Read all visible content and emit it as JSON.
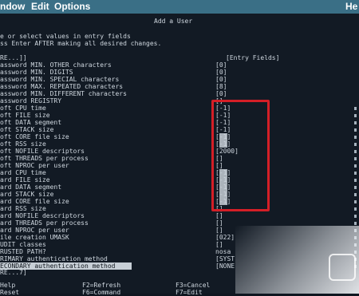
{
  "menubar": {
    "items": [
      "ndow",
      "Edit",
      "Options"
    ],
    "right_label": "He"
  },
  "dialog": {
    "title": "Add a User",
    "instructions": [
      "e or select values in entry fields",
      "ss Enter AFTER making all desired changes."
    ],
    "list_top": "RE...]]",
    "column_header": "[Entry Fields]",
    "list_more": "RE...7]"
  },
  "fields": [
    {
      "label": "assword MIN. OTHER characters",
      "value": "[0]"
    },
    {
      "label": "assword MIN. DIGITS",
      "value": "[0]"
    },
    {
      "label": "assword MIN. SPECIAL characters",
      "value": "[0]"
    },
    {
      "label": "assword MAX. REPEATED characters",
      "value": "[8]"
    },
    {
      "label": "assword MIN. DIFFERENT characters",
      "value": "[0]"
    },
    {
      "label": "assword REGISTRY",
      "value": "[]"
    },
    {
      "label": "oft CPU time",
      "value": "[-1]"
    },
    {
      "label": "oft FILE size",
      "value": "[-1]"
    },
    {
      "label": "oft DATA segment",
      "value": "[-1]"
    },
    {
      "label": "oft STACK size",
      "value": "[-1]"
    },
    {
      "label": "oft CORE file size",
      "value": "[-1]"
    },
    {
      "label": "oft RSS size",
      "value": "[-1]"
    },
    {
      "label": "oft NOFILE descriptors",
      "value": "[2000]"
    },
    {
      "label": "oft THREADS per process",
      "value": "[]"
    },
    {
      "label": "oft NPROC per user",
      "value": "[]"
    },
    {
      "label": "ard CPU time",
      "value": "[-1]"
    },
    {
      "label": "ard FILE size",
      "value": "[-1]"
    },
    {
      "label": "ard DATA segment",
      "value": "[-1]"
    },
    {
      "label": "ard STACK size",
      "value": "[-1]"
    },
    {
      "label": "ard CORE file size",
      "value": "[-1]"
    },
    {
      "label": "ard RSS size",
      "value": "[]"
    },
    {
      "label": "ard NOFILE descriptors",
      "value": "[]"
    },
    {
      "label": "ard THREADS per process",
      "value": "[]"
    },
    {
      "label": "ard NPROC per user",
      "value": "[]"
    },
    {
      "label": "ile creation UMASK",
      "value": "[022]"
    },
    {
      "label": "UDIT classes",
      "value": "[]"
    },
    {
      "label": "RUSTED PATH?",
      "value": "nosa"
    },
    {
      "label": "RIMARY authentication method",
      "value": "[SYST"
    },
    {
      "label": "ECONDARY authentication method",
      "value": "[NONE"
    }
  ],
  "function_keys": {
    "row1": [
      "Help",
      "F2=Refresh",
      "F3=Cancel"
    ],
    "row2": [
      "Reset",
      "F6=Command",
      "F7=Edit"
    ]
  }
}
